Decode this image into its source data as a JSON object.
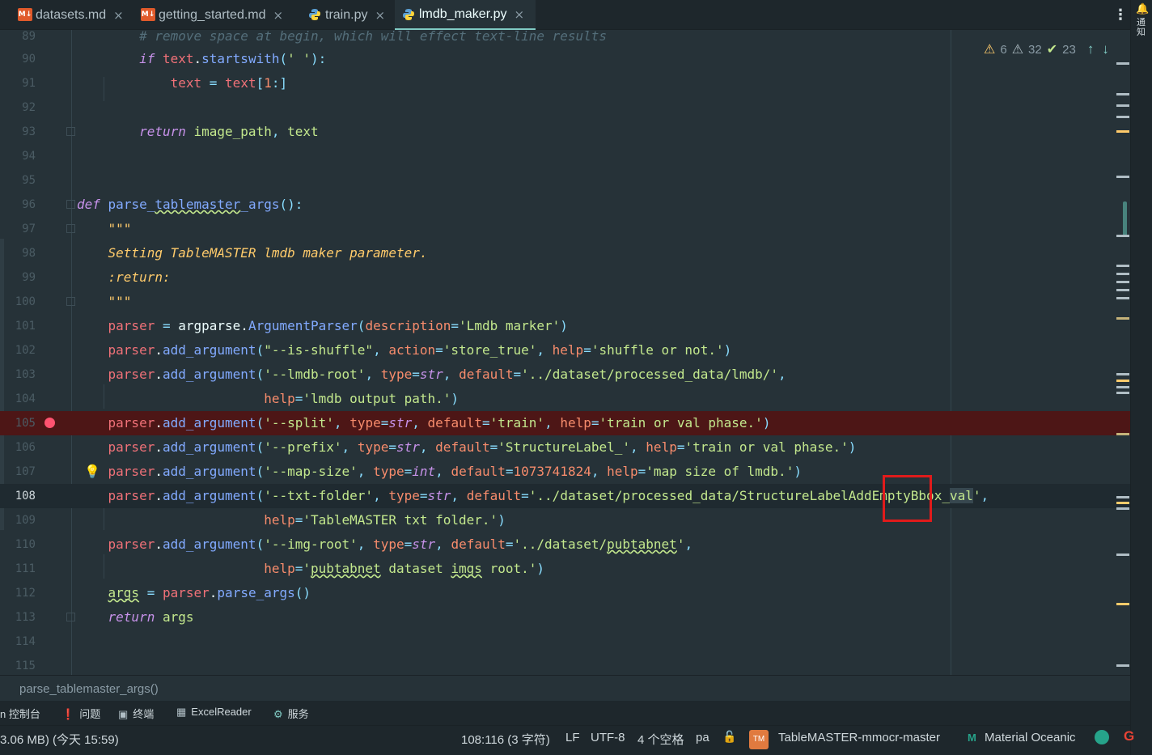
{
  "tabs": [
    {
      "label": "datasets.md",
      "icon": "markdown-icon",
      "active": false
    },
    {
      "label": "getting_started.md",
      "icon": "markdown-icon",
      "active": false
    },
    {
      "label": "train.py",
      "icon": "python-icon",
      "active": false
    },
    {
      "label": "lmdb_maker.py",
      "icon": "python-icon",
      "active": true
    }
  ],
  "tab_close": "×",
  "tab_menu": "⋮",
  "md_badge": "M↓",
  "notify_label": "通知",
  "inspection": {
    "warnings_yellow": "6",
    "warnings_grey": "32",
    "weak_warnings": "23"
  },
  "code_lines": [
    {
      "n": "89",
      "text": "        # remove space at begin, which will effect text-line results"
    },
    {
      "n": "90",
      "text": "        if text.startswith(' '):"
    },
    {
      "n": "91",
      "text": "            text = text[1:]"
    },
    {
      "n": "92",
      "text": ""
    },
    {
      "n": "93",
      "text": "        return image_path, text"
    },
    {
      "n": "94",
      "text": ""
    },
    {
      "n": "95",
      "text": ""
    },
    {
      "n": "96",
      "text": "def parse_tablemaster_args():"
    },
    {
      "n": "97",
      "text": "    \"\"\""
    },
    {
      "n": "98",
      "text": "    Setting TableMASTER lmdb maker parameter."
    },
    {
      "n": "99",
      "text": "    :return:"
    },
    {
      "n": "100",
      "text": "    \"\"\""
    },
    {
      "n": "101",
      "text": "    parser = argparse.ArgumentParser(description='Lmdb marker')"
    },
    {
      "n": "102",
      "text": "    parser.add_argument(\"--is-shuffle\", action='store_true', help='shuffle or not.')"
    },
    {
      "n": "103",
      "text": "    parser.add_argument('--lmdb-root', type=str, default='../dataset/processed_data/lmdb/',"
    },
    {
      "n": "104",
      "text": "                        help='lmdb output path.')"
    },
    {
      "n": "105",
      "text": "    parser.add_argument('--split', type=str, default='train', help='train or val phase.')"
    },
    {
      "n": "106",
      "text": "    parser.add_argument('--prefix', type=str, default='StructureLabel_', help='train or val phase.')"
    },
    {
      "n": "107",
      "text": "    parser.add_argument('--map-size', type=int, default=1073741824, help='map size of lmdb.')"
    },
    {
      "n": "108",
      "text": "    parser.add_argument('--txt-folder', type=str, default='../dataset/processed_data/StructureLabelAddEmptyBbox_val',"
    },
    {
      "n": "109",
      "text": "                        help='TableMASTER txt folder.')"
    },
    {
      "n": "110",
      "text": "    parser.add_argument('--img-root', type=str, default='../dataset/pubtabnet',"
    },
    {
      "n": "111",
      "text": "                        help='pubtabnet dataset imgs root.')"
    },
    {
      "n": "112",
      "text": "    args = parser.parse_args()"
    },
    {
      "n": "113",
      "text": "    return args"
    },
    {
      "n": "114",
      "text": ""
    },
    {
      "n": "115",
      "text": ""
    }
  ],
  "breadcrumb": "parse_tablemaster_args()",
  "tool_windows": [
    {
      "label": "n 控制台",
      "icon": ""
    },
    {
      "label": "问题",
      "icon": "problems-icon"
    },
    {
      "label": "终端",
      "icon": "terminal-icon"
    },
    {
      "label": "ExcelReader",
      "icon": "excel-icon"
    },
    {
      "label": "服务",
      "icon": "services-icon"
    }
  ],
  "status": {
    "memory": "3.06 MB) (今天 15:59)",
    "position": "108:116 (3 字符)",
    "line_sep": "LF",
    "encoding": "UTF-8",
    "indent": "4 个空格",
    "interpreter": "pa",
    "project_badge": "TM",
    "project": "TableMASTER-mmocr-master",
    "theme": "Material Oceanic",
    "theme_icon": "M",
    "google": "G"
  },
  "colors": {
    "accent": "#80cbc4",
    "breakpoint_line": "#4d1616",
    "highlight_box": "#e01b1b",
    "background": "#263238"
  }
}
